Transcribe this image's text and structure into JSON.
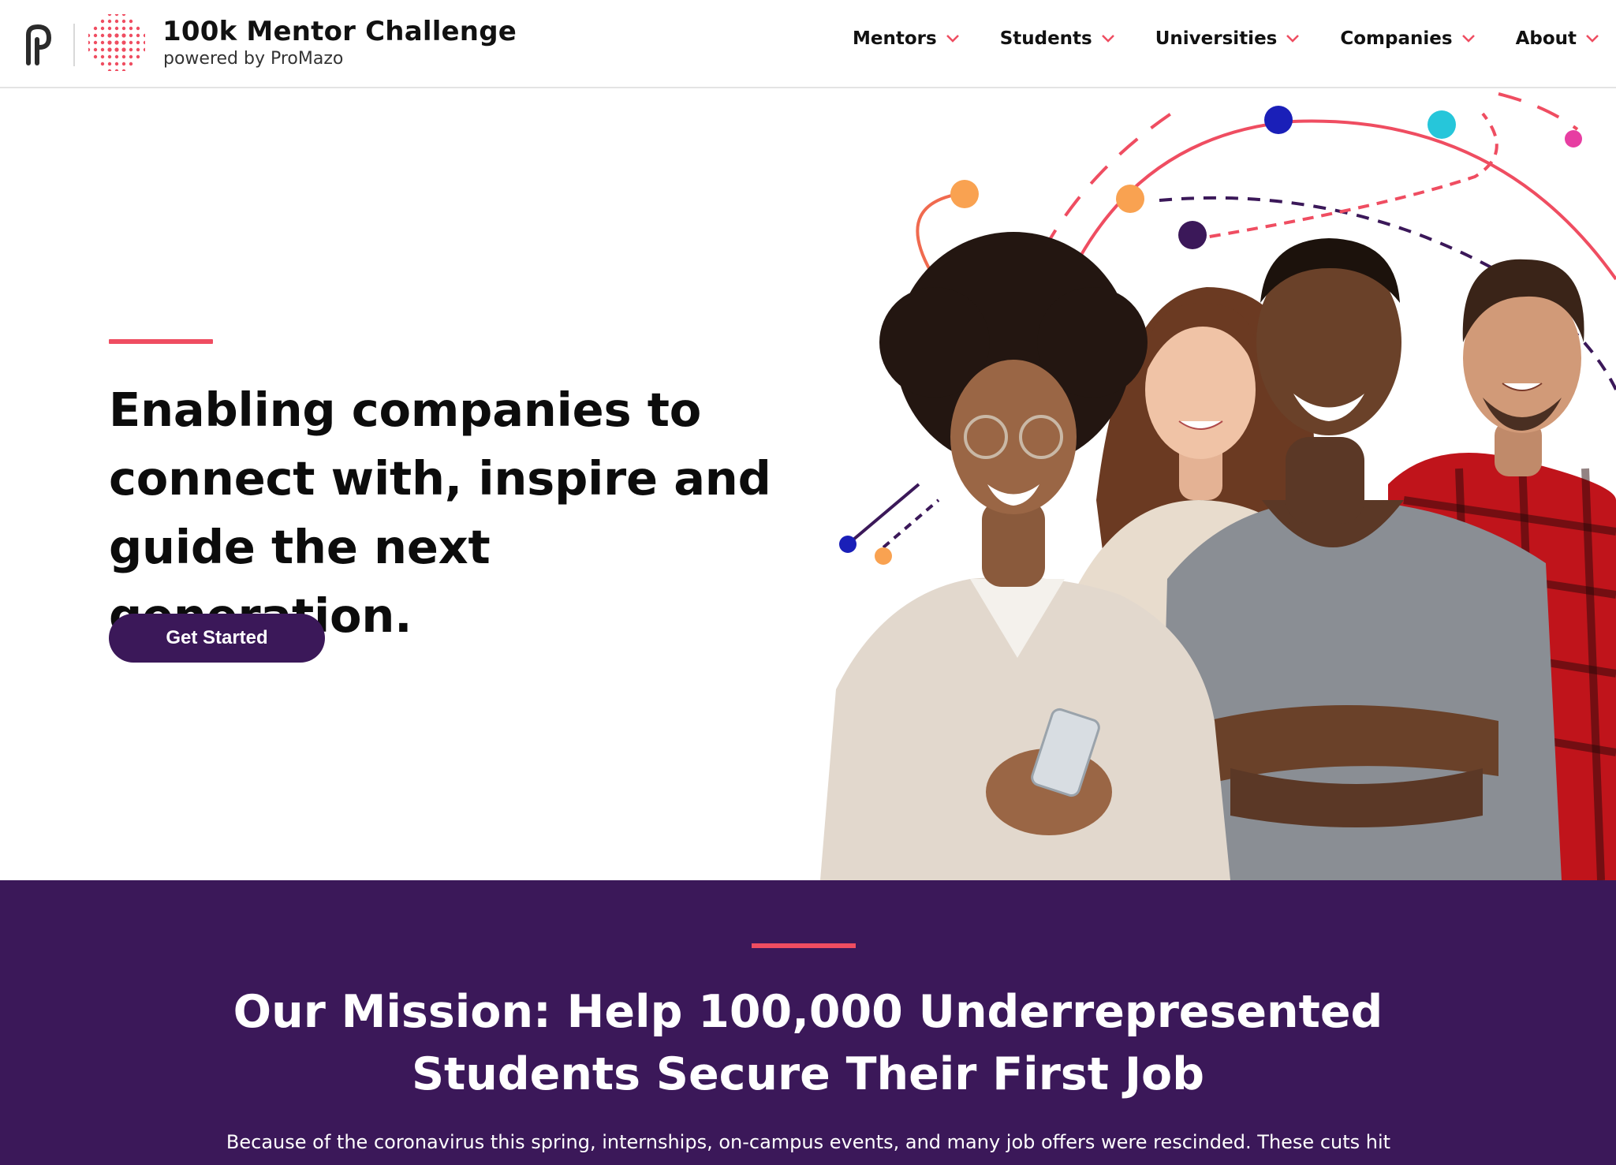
{
  "header": {
    "brand_title": "100k Mentor Challenge",
    "brand_subtitle": "powered by ProMazo",
    "nav": [
      {
        "label": "Mentors",
        "icon": "chevron-down-icon"
      },
      {
        "label": "Students",
        "icon": "chevron-down-icon"
      },
      {
        "label": "Universities",
        "icon": "chevron-down-icon"
      },
      {
        "label": "Companies",
        "icon": "chevron-down-icon"
      },
      {
        "label": "About",
        "icon": "chevron-down-icon"
      }
    ]
  },
  "hero": {
    "heading": "Enabling companies to connect with, inspire and guide the next generation.",
    "cta_label": "Get Started"
  },
  "mission": {
    "heading_line1": "Our Mission: Help 100,000 Underrepresented",
    "heading_line2": "Students Secure Their First Job",
    "body": "Because of the coronavirus this spring, internships, on-campus events, and many job offers were rescinded. These cuts hit"
  },
  "colors": {
    "brand_purple": "#3b1859",
    "accent_coral": "#ef4d61",
    "nav_chevron": "#ef4d61"
  }
}
